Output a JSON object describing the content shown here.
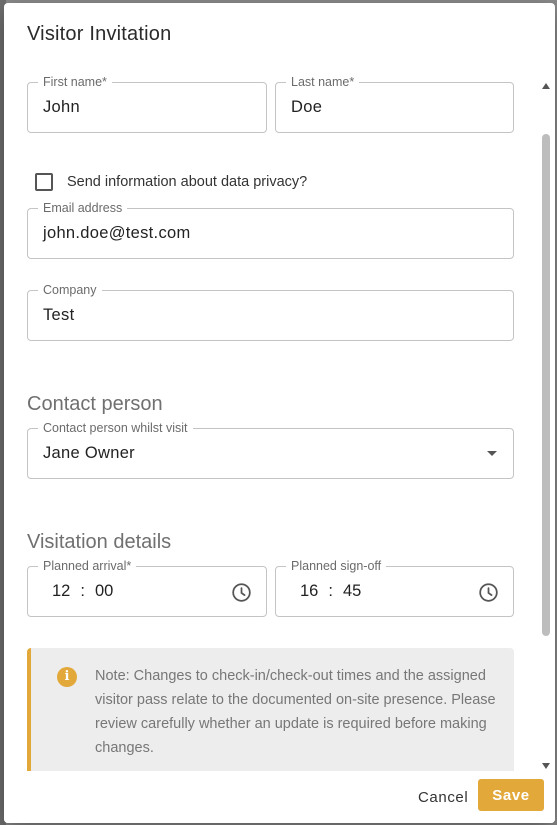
{
  "dialog": {
    "title": "Visitor Invitation"
  },
  "form": {
    "first_name": {
      "label": "First name*",
      "value": "John"
    },
    "last_name": {
      "label": "Last name*",
      "value": "Doe"
    },
    "privacy_checkbox": {
      "label": "Send information about data privacy?",
      "checked": false
    },
    "email": {
      "label": "Email address",
      "value": "john.doe@test.com"
    },
    "company": {
      "label": "Company",
      "value": "Test"
    }
  },
  "contact_section": {
    "heading": "Contact person",
    "contact_select": {
      "label": "Contact person whilst visit",
      "value": "Jane Owner"
    }
  },
  "visitation_section": {
    "heading": "Visitation details",
    "planned_arrival": {
      "label": "Planned arrival*",
      "hour": "12",
      "separator": ":",
      "minute": "00"
    },
    "planned_signoff": {
      "label": "Planned sign-off",
      "hour": "16",
      "separator": ":",
      "minute": "45"
    }
  },
  "note": {
    "icon": "info-icon",
    "icon_glyph": "i",
    "text": "Note: Changes to check-in/check-out times and the assigned visitor pass relate to the documented on-site presence. Please review carefully whether an update is required before making changes."
  },
  "footer": {
    "cancel_label": "Cancel",
    "save_label": "Save"
  },
  "colors": {
    "accent": "#e3a83a",
    "note_background": "#ededed"
  }
}
